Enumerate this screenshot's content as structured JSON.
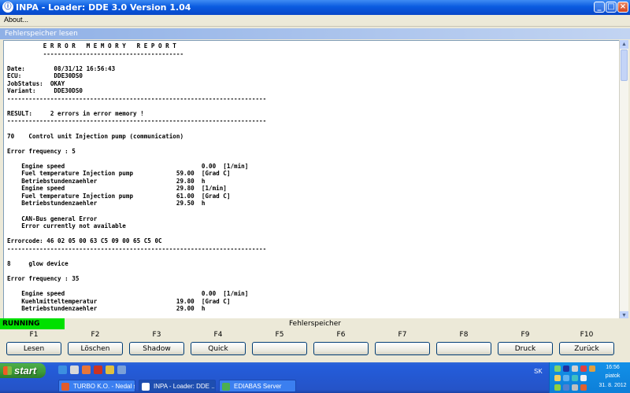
{
  "window": {
    "title": "INPA - Loader:  DDE 3.0 Version 1.04",
    "app_icon": "inpa-app-icon"
  },
  "menu": {
    "items": [
      "About..."
    ]
  },
  "panel": {
    "title": "Fehlerspeicher lesen"
  },
  "report_lines": [
    "          E R R O R   M E M O R Y   R E P O R T",
    "          ---------------------------------------",
    "",
    "Date:        08/31/12 16:56:43",
    "ECU:         DDE30DS0",
    "JobStatus:  OKAY",
    "Variant:     DDE30DS0",
    "------------------------------------------------------------------------",
    "",
    "RESULT:     2 errors in error memory !",
    "------------------------------------------------------------------------",
    "",
    "70    Control unit Injection pump (communication)",
    "",
    "Error frequency : 5",
    "",
    "    Engine speed                                      0.00  [1/min]",
    "    Fuel temperature Injection pump            59.00  [Grad C]",
    "    Betriebstundenzaehler                      29.80  h",
    "    Engine speed                               29.80  [1/min]",
    "    Fuel temperature Injection pump            61.00  [Grad C]",
    "    Betriebstundenzaehler                      29.50  h",
    "",
    "    CAN-Bus general Error",
    "    Error currently not available",
    "",
    "Errorcode: 46 02 05 00 63 C5 09 00 65 C5 0C",
    "------------------------------------------------------------------------",
    "",
    "8     glow device",
    "",
    "Error frequency : 35",
    "",
    "    Engine speed                                      0.00  [1/min]",
    "    Kuehlmitteltemperatur                      19.00  [Grad C]",
    "    Betriebstundenzaehler                      29.00  h"
  ],
  "status": {
    "running": "RUNNING",
    "title": "Fehlerspeicher"
  },
  "fkeys": [
    {
      "key": "F1",
      "label": "Lesen"
    },
    {
      "key": "F2",
      "label": "Löschen"
    },
    {
      "key": "F3",
      "label": "Shadow"
    },
    {
      "key": "F4",
      "label": "Quick"
    },
    {
      "key": "F5",
      "label": ""
    },
    {
      "key": "F6",
      "label": ""
    },
    {
      "key": "F7",
      "label": ""
    },
    {
      "key": "F8",
      "label": ""
    },
    {
      "key": "F9",
      "label": "Druck"
    },
    {
      "key": "F10",
      "label": "Zurück"
    }
  ],
  "taskbar": {
    "start_label": "start",
    "tasks": [
      {
        "label": "TURBO K.O. - Nedal s...",
        "active": false,
        "icon_color": "#e25b2a"
      },
      {
        "label": "INPA - Loader:  DDE ...",
        "active": true,
        "icon_color": "#ffffff"
      },
      {
        "label": "EDIABAS Server",
        "active": false,
        "icon_color": "#4caf50"
      }
    ],
    "lang": "SK",
    "clock": {
      "time": "16:56",
      "day": "piatok",
      "date": "31. 8. 2012"
    }
  }
}
